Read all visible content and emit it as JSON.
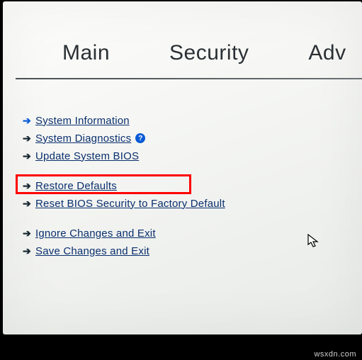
{
  "tabs": {
    "main": "Main",
    "security": "Security",
    "advanced": "Adv"
  },
  "menu": {
    "group1": [
      {
        "label": "System Information",
        "selected": true,
        "help": false
      },
      {
        "label": "System Diagnostics",
        "selected": false,
        "help": true
      },
      {
        "label": "Update System BIOS",
        "selected": false,
        "help": false
      }
    ],
    "group2": [
      {
        "label": "Restore Defaults",
        "selected": false,
        "highlighted": true
      },
      {
        "label": "Reset BIOS Security to Factory Default",
        "selected": false
      }
    ],
    "group3": [
      {
        "label": "Ignore Changes and Exit",
        "selected": false
      },
      {
        "label": "Save Changes and Exit",
        "selected": false
      }
    ]
  },
  "watermark": "wsxdn.com"
}
